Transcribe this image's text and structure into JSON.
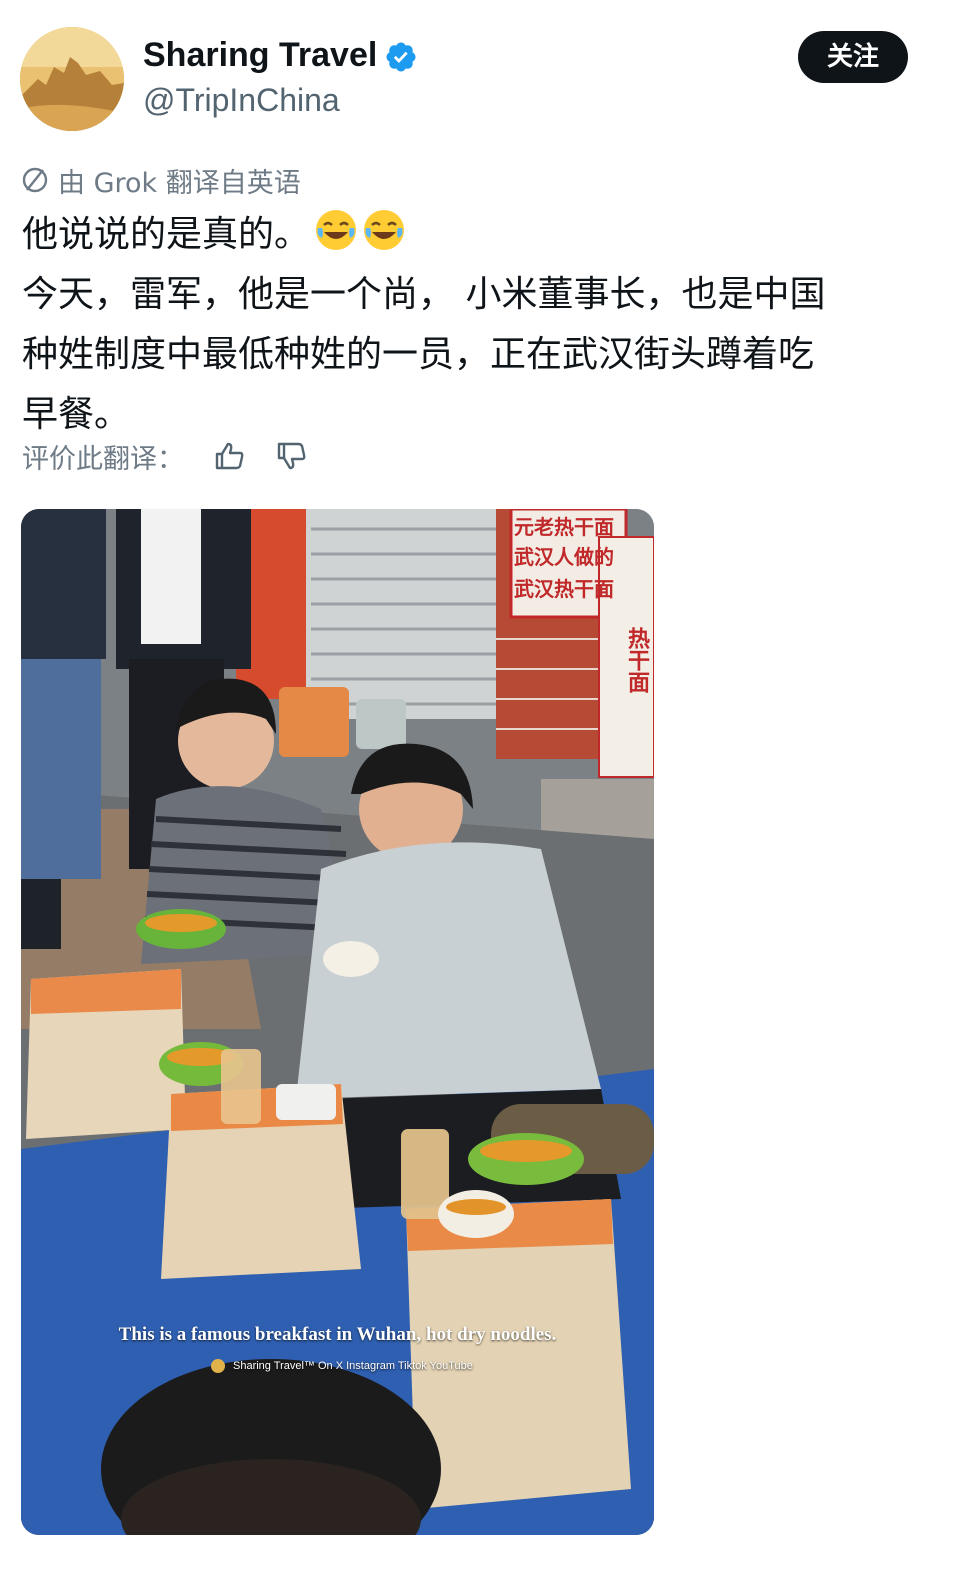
{
  "account": {
    "display_name": "Sharing Travel",
    "handle": "@TripInChina",
    "verified": true,
    "follow_label": "关注"
  },
  "translation": {
    "notice": "由 Grok 翻译自英语",
    "icon": "globe-icon"
  },
  "post": {
    "line1": "他说说的是真的。",
    "line1_emoji": [
      "face-with-tears-of-joy",
      "face-with-tears-of-joy"
    ],
    "line2": "今天，雷军，他是一个尚， 小米董事长，也是中国",
    "line3": "种姓制度中最低种姓的一员，正在武汉街头蹲着吃",
    "line4": "早餐。"
  },
  "rate": {
    "label": "评价此翻译：",
    "thumbs_up_icon": "thumbs-up-icon",
    "thumbs_down_icon": "thumbs-down-icon"
  },
  "media": {
    "caption": "This is a famous breakfast in Wuhan, hot dry noodles.",
    "watermark": "Sharing Travel™ On X Instagram Tiktok YouTube",
    "sign_lines": [
      "元老热干面",
      "武汉人做的",
      "武汉热干面"
    ],
    "side_sign": "热干面"
  },
  "colors": {
    "verified_blue": "#1d9bf0",
    "text_primary": "#0f1419",
    "text_secondary": "#536471",
    "follow_bg": "#0f1419"
  }
}
